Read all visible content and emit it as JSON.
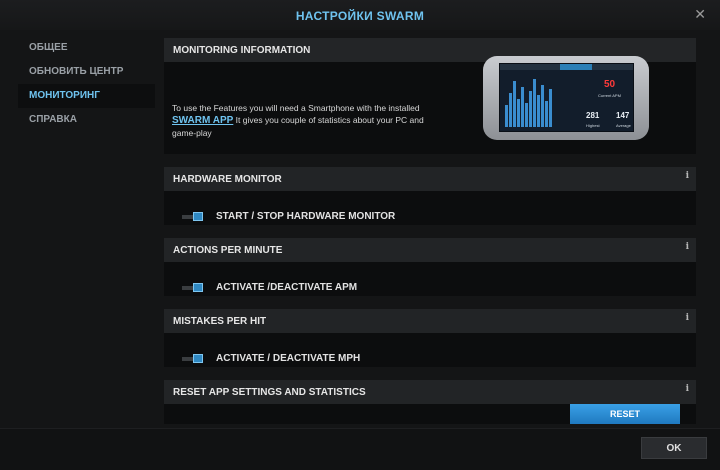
{
  "window": {
    "title": "НАСТРОЙКИ SWARM",
    "close_icon": "close-icon"
  },
  "sidebar": {
    "items": [
      {
        "label": "ОБЩЕЕ",
        "active": false
      },
      {
        "label": "ОБНОВИТЬ ЦЕНТР",
        "active": false
      },
      {
        "label": "МОНИТОРИНГ",
        "active": true
      },
      {
        "label": "СПРАВКА",
        "active": false
      }
    ]
  },
  "monitoring": {
    "header": "MONITORING INFORMATION",
    "text_before": "To use the Features you will need a Smartphone with the installed ",
    "link": "SWARM APP",
    "text_after": " It gives you couple of statistics about your PC and game-play",
    "phone": {
      "big_number": "50",
      "big_label": "Current APM",
      "left_number": "281",
      "left_label": "Highest",
      "right_number": "147",
      "right_label": "Average"
    }
  },
  "hardware": {
    "header": "HARDWARE MONITOR",
    "toggle_label": "START / STOP HARDWARE MONITOR",
    "info": "i"
  },
  "apm": {
    "header": "ACTIONS PER MINUTE",
    "toggle_label": "ACTIVATE /DEACTIVATE APM",
    "info": "i"
  },
  "mph": {
    "header": "MISTAKES PER HIT",
    "toggle_label": "ACTIVATE / DEACTIVATE MPH",
    "info": "i"
  },
  "reset": {
    "header": "RESET APP SETTINGS AND STATISTICS",
    "button": "RESET",
    "info": "i"
  },
  "footer": {
    "ok": "OK"
  },
  "colors": {
    "accent": "#6fc3ef",
    "button": "#2a8ad4",
    "highlight_number": "#ff3a3a"
  }
}
